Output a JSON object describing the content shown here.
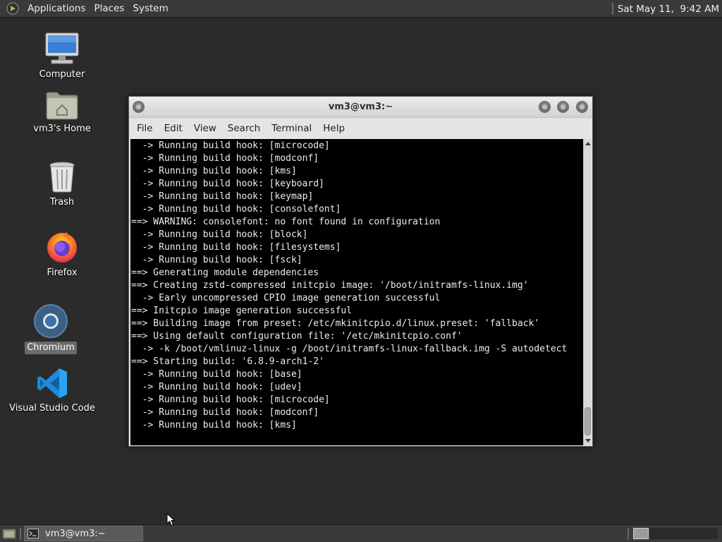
{
  "top_panel": {
    "menus": [
      "Applications",
      "Places",
      "System"
    ],
    "clock": "Sat May 11,  9:42 AM",
    "logo_icon": "distro-logo-icon"
  },
  "desktop": {
    "icons": [
      {
        "label": "Computer",
        "icon": "computer-icon"
      },
      {
        "label": "vm3's Home",
        "icon": "home-folder-icon"
      },
      {
        "label": "Trash",
        "icon": "trash-icon"
      },
      {
        "label": "Firefox",
        "icon": "firefox-icon"
      },
      {
        "label": "Chromium",
        "icon": "chromium-icon",
        "selected": true
      },
      {
        "label": "Visual Studio Code",
        "icon": "vscode-icon"
      }
    ]
  },
  "terminal_window": {
    "title": "vm3@vm3:~",
    "menu": [
      "File",
      "Edit",
      "View",
      "Search",
      "Terminal",
      "Help"
    ],
    "lines": [
      "  -> Running build hook: [microcode]",
      "  -> Running build hook: [modconf]",
      "  -> Running build hook: [kms]",
      "  -> Running build hook: [keyboard]",
      "  -> Running build hook: [keymap]",
      "  -> Running build hook: [consolefont]",
      "==> WARNING: consolefont: no font found in configuration",
      "  -> Running build hook: [block]",
      "  -> Running build hook: [filesystems]",
      "  -> Running build hook: [fsck]",
      "==> Generating module dependencies",
      "==> Creating zstd-compressed initcpio image: '/boot/initramfs-linux.img'",
      "  -> Early uncompressed CPIO image generation successful",
      "==> Initcpio image generation successful",
      "==> Building image from preset: /etc/mkinitcpio.d/linux.preset: 'fallback'",
      "==> Using default configuration file: '/etc/mkinitcpio.conf'",
      "  -> -k /boot/vmlinuz-linux -g /boot/initramfs-linux-fallback.img -S autodetect",
      "==> Starting build: '6.8.9-arch1-2'",
      "  -> Running build hook: [base]",
      "  -> Running build hook: [udev]",
      "  -> Running build hook: [microcode]",
      "  -> Running build hook: [modconf]",
      "  -> Running build hook: [kms]"
    ]
  },
  "bottom_panel": {
    "task_label": "vm3@vm3:~",
    "task_icon": "terminal-icon",
    "workspaces": 2,
    "active_workspace": 1
  },
  "colors": {
    "desktop_bg": "#2b2b2b",
    "panel_bg": "#3a3a3a",
    "terminal_bg": "#000000",
    "terminal_fg": "#ececec"
  }
}
